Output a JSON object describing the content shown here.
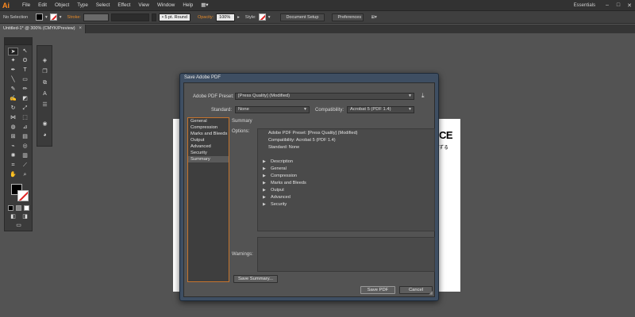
{
  "app": {
    "logo": "Ai",
    "menu": [
      "File",
      "Edit",
      "Object",
      "Type",
      "Select",
      "Effect",
      "View",
      "Window",
      "Help"
    ],
    "workspace": "Essentials",
    "window_controls": [
      "–",
      "□",
      "✕"
    ]
  },
  "control_bar": {
    "selection_label": "No Selection",
    "stroke_label": "Stroke:",
    "brush_value": "5 pt. Round",
    "opacity_label": "Opacity:",
    "opacity_value": "100%",
    "style_label": "Style:",
    "document_setup": "Document Setup",
    "preferences": "Preferences"
  },
  "document_tab": {
    "title": "Untitled-1* @ 300% (CMYK/Preview)",
    "close": "×"
  },
  "artboard": {
    "visible_text": "CE",
    "visible_subtext": "ずる"
  },
  "dialog": {
    "title": "Save Adobe PDF",
    "preset_label": "Adobe PDF Preset:",
    "preset_value": "[Press Quality] (Modified)",
    "standard_label": "Standard:",
    "standard_value": "None",
    "compatibility_label": "Compatibility:",
    "compatibility_value": "Acrobat 5 (PDF 1.4)",
    "categories": [
      "General",
      "Compression",
      "Marks and Bleeds",
      "Output",
      "Advanced",
      "Security",
      "Summary"
    ],
    "selected_category": "Summary",
    "section_title": "Summary",
    "options_label": "Options:",
    "options_summary": [
      "Adobe PDF Preset: [Press Quality] (Modified)",
      "Compatibility: Acrobat 5 (PDF 1.4)",
      "Standard: None"
    ],
    "option_groups": [
      "Description",
      "General",
      "Compression",
      "Marks and Bleeds",
      "Output",
      "Advanced",
      "Security"
    ],
    "warnings_label": "Warnings:",
    "save_summary_button": "Save Summary...",
    "save_button": "Save PDF",
    "cancel_button": "Cancel"
  },
  "colors": {
    "accent": "#e3892a",
    "app_bg": "#535353",
    "dialog_frame": "#3e4e62"
  }
}
